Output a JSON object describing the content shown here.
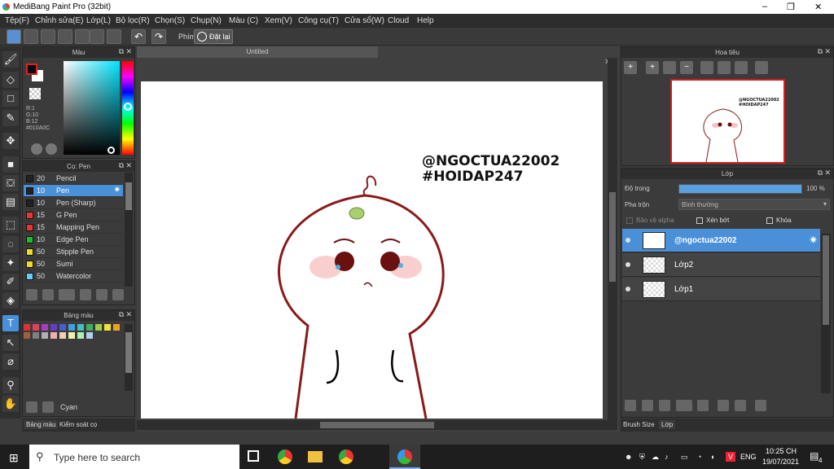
{
  "window": {
    "title": "MediBang Paint Pro (32bit)"
  },
  "menu": [
    "Tệp(F)",
    "Chỉnh sửa(E)",
    "Lớp(L)",
    "Bộ lọc(R)",
    "Chọn(S)",
    "Chụp(N)",
    "Màu (C)",
    "Xem(V)",
    "Công cụ(T)",
    "Cửa sổ(W)",
    "Cloud",
    "Help"
  ],
  "toolbar": {
    "key_label": "Phím",
    "reset_label": "Đặt lại"
  },
  "color_panel": {
    "title": "Màu",
    "r": "R:1",
    "g": "G:10",
    "b": "B:12",
    "hex": "#010A0C",
    "fg_color": "#010A0C"
  },
  "brush_panel": {
    "title": "Cọ: Pen",
    "items": [
      {
        "size": "20",
        "name": "Pencil",
        "color": "#222222"
      },
      {
        "size": "10",
        "name": "Pen",
        "color": "#222222",
        "selected": true
      },
      {
        "size": "10",
        "name": "Pen (Sharp)",
        "color": "#222222"
      },
      {
        "size": "15",
        "name": "G Pen",
        "color": "#ee3333"
      },
      {
        "size": "15",
        "name": "Mapping Pen",
        "color": "#ee3333"
      },
      {
        "size": "10",
        "name": "Edge Pen",
        "color": "#22bb22"
      },
      {
        "size": "50",
        "name": "Stipple Pen",
        "color": "#eedd22"
      },
      {
        "size": "50",
        "name": "Sumi",
        "color": "#eedd22"
      },
      {
        "size": "50",
        "name": "Watercolor",
        "color": "#66ccff"
      }
    ]
  },
  "palette_panel": {
    "title": "Bảng màu",
    "current": "Cyan",
    "swatches": [
      "#e03030",
      "#e04060",
      "#a040c0",
      "#6040c0",
      "#4060d0",
      "#40a0e0",
      "#40c0c0",
      "#40b060",
      "#a0d040",
      "#f0e040",
      "#f0a020",
      "#a06040",
      "#808080",
      "#b0b0b0",
      "#f0b0b0",
      "#f0d0b0",
      "#f0f0b0",
      "#b0f0b0",
      "#b0d0f0"
    ]
  },
  "bottom_tabs": [
    "Bảng màu",
    "Kiểm soát cọ"
  ],
  "canvas": {
    "tab": "Untitled",
    "text_line1": "@NGOCTUA22002",
    "text_line2": "#HOIDAP247"
  },
  "navigator": {
    "title": "Hoa tiêu",
    "preview_line1": "@NGOCTUA22002",
    "preview_line2": "#HOIDAP247"
  },
  "layer_panel": {
    "title": "Lớp",
    "opacity_label": "Độ trong",
    "opacity_value": "100 %",
    "opacity": 1.0,
    "blend_label": "Pha trộn",
    "blend_value": "Bình thường",
    "protect_alpha": "Bảo vệ alpha",
    "clipping": "Xén bớt",
    "lock": "Khóa",
    "layers": [
      {
        "name": "@ngoctua22002",
        "selected": true
      },
      {
        "name": "Lớp2"
      },
      {
        "name": "Lớp1"
      }
    ]
  },
  "right_tabs": [
    "Brush Size",
    "Lớp"
  ],
  "taskbar": {
    "search_placeholder": "Type here to search",
    "lang": "ENG",
    "time": "10:25 CH",
    "date": "19/07/2021",
    "notifications": "4"
  }
}
